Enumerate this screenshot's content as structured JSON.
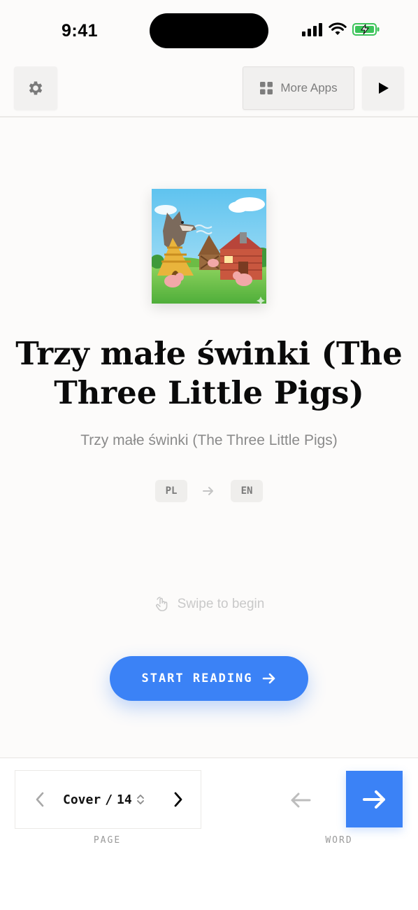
{
  "status_bar": {
    "time": "9:41",
    "icons": [
      "cellular-signal-icon",
      "wifi-icon",
      "battery-charging-icon"
    ]
  },
  "toolbar": {
    "settings_icon": "gear-icon",
    "more_apps_label": "More Apps",
    "more_apps_icon": "grid-icon",
    "play_icon": "play-icon"
  },
  "book": {
    "title": "Trzy małe świnki (The Three Little Pigs)",
    "subtitle": "Trzy małe świnki (The Three Little Pigs)",
    "source_language": "PL",
    "target_language": "EN"
  },
  "swipe_hint": "Swipe to begin",
  "start_button": {
    "label": "START READING"
  },
  "page_nav": {
    "current": "Cover",
    "separator": "/",
    "total": "14",
    "caption": "PAGE"
  },
  "word_nav": {
    "caption": "WORD"
  },
  "colors": {
    "accent": "#3b82f6",
    "background": "#fcfbfa",
    "muted_text": "#8a8a8a"
  }
}
